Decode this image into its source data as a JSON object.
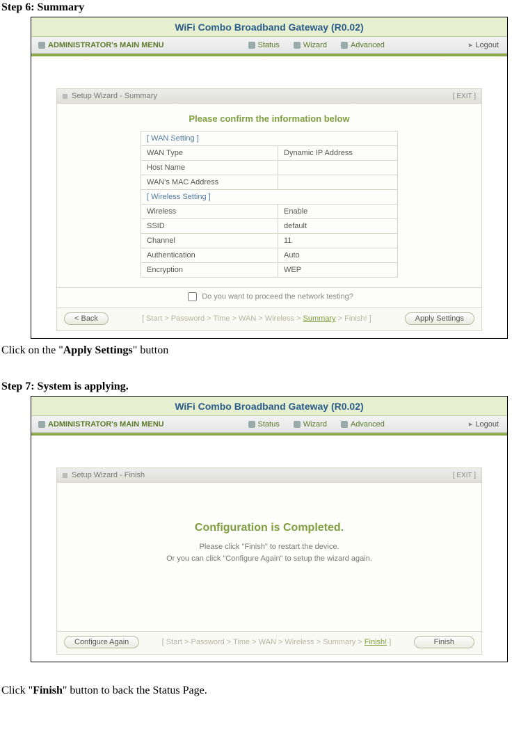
{
  "step6": {
    "heading": "Step 6: Summary",
    "instruction_pre": "Click on the \"",
    "instruction_bold": "Apply Settings",
    "instruction_post": "\" button",
    "product_title": "WiFi Combo Broadband Gateway (R0.02)",
    "menu": {
      "main": "ADMINISTRATOR's MAIN MENU",
      "status": "Status",
      "wizard": "Wizard",
      "advanced": "Advanced",
      "logout": "Logout"
    },
    "panel_title": "Setup Wizard - Summary",
    "exit": "[ EXIT ]",
    "confirm": "Please confirm the information below",
    "wan_section": "[ WAN Setting ]",
    "rows_wan": [
      {
        "label": "WAN Type",
        "value": "Dynamic IP Address"
      },
      {
        "label": "Host Name",
        "value": ""
      },
      {
        "label": "WAN's MAC Address",
        "value": ""
      }
    ],
    "wireless_section": "[ Wireless Setting ]",
    "rows_wireless": [
      {
        "label": "Wireless",
        "value": "Enable"
      },
      {
        "label": "SSID",
        "value": "default"
      },
      {
        "label": "Channel",
        "value": "11"
      },
      {
        "label": "Authentication",
        "value": "Auto"
      },
      {
        "label": "Encryption",
        "value": "WEP"
      }
    ],
    "proceed": "Do you want to proceed the network testing?",
    "back_btn": "< Back",
    "apply_btn": "Apply Settings",
    "crumbs_plain": "[ Start > Password > Time > WAN > Wireless > ",
    "crumbs_current": "Summary",
    "crumbs_tail": " > Finish! ]"
  },
  "step7": {
    "heading": "Step 7: System is applying.",
    "instruction_pre": "Click \"",
    "instruction_bold": "Finish",
    "instruction_post": "\" button to back the Status Page.",
    "product_title": "WiFi Combo Broadband Gateway (R0.02)",
    "menu": {
      "main": "ADMINISTRATOR's MAIN MENU",
      "status": "Status",
      "wizard": "Wizard",
      "advanced": "Advanced",
      "logout": "Logout"
    },
    "panel_title": "Setup Wizard - Finish",
    "exit": "[ EXIT ]",
    "completed": "Configuration is Completed.",
    "sub1": "Please click \"Finish\" to restart the device.",
    "sub2": "Or you can click \"Configure Again\" to setup the wizard again.",
    "config_again_btn": "Configure Again",
    "finish_btn": "Finish",
    "crumbs_plain": "[ Start > Password > Time > WAN > Wireless > Summary > ",
    "crumbs_current": "Finish!",
    "crumbs_tail": " ]"
  }
}
